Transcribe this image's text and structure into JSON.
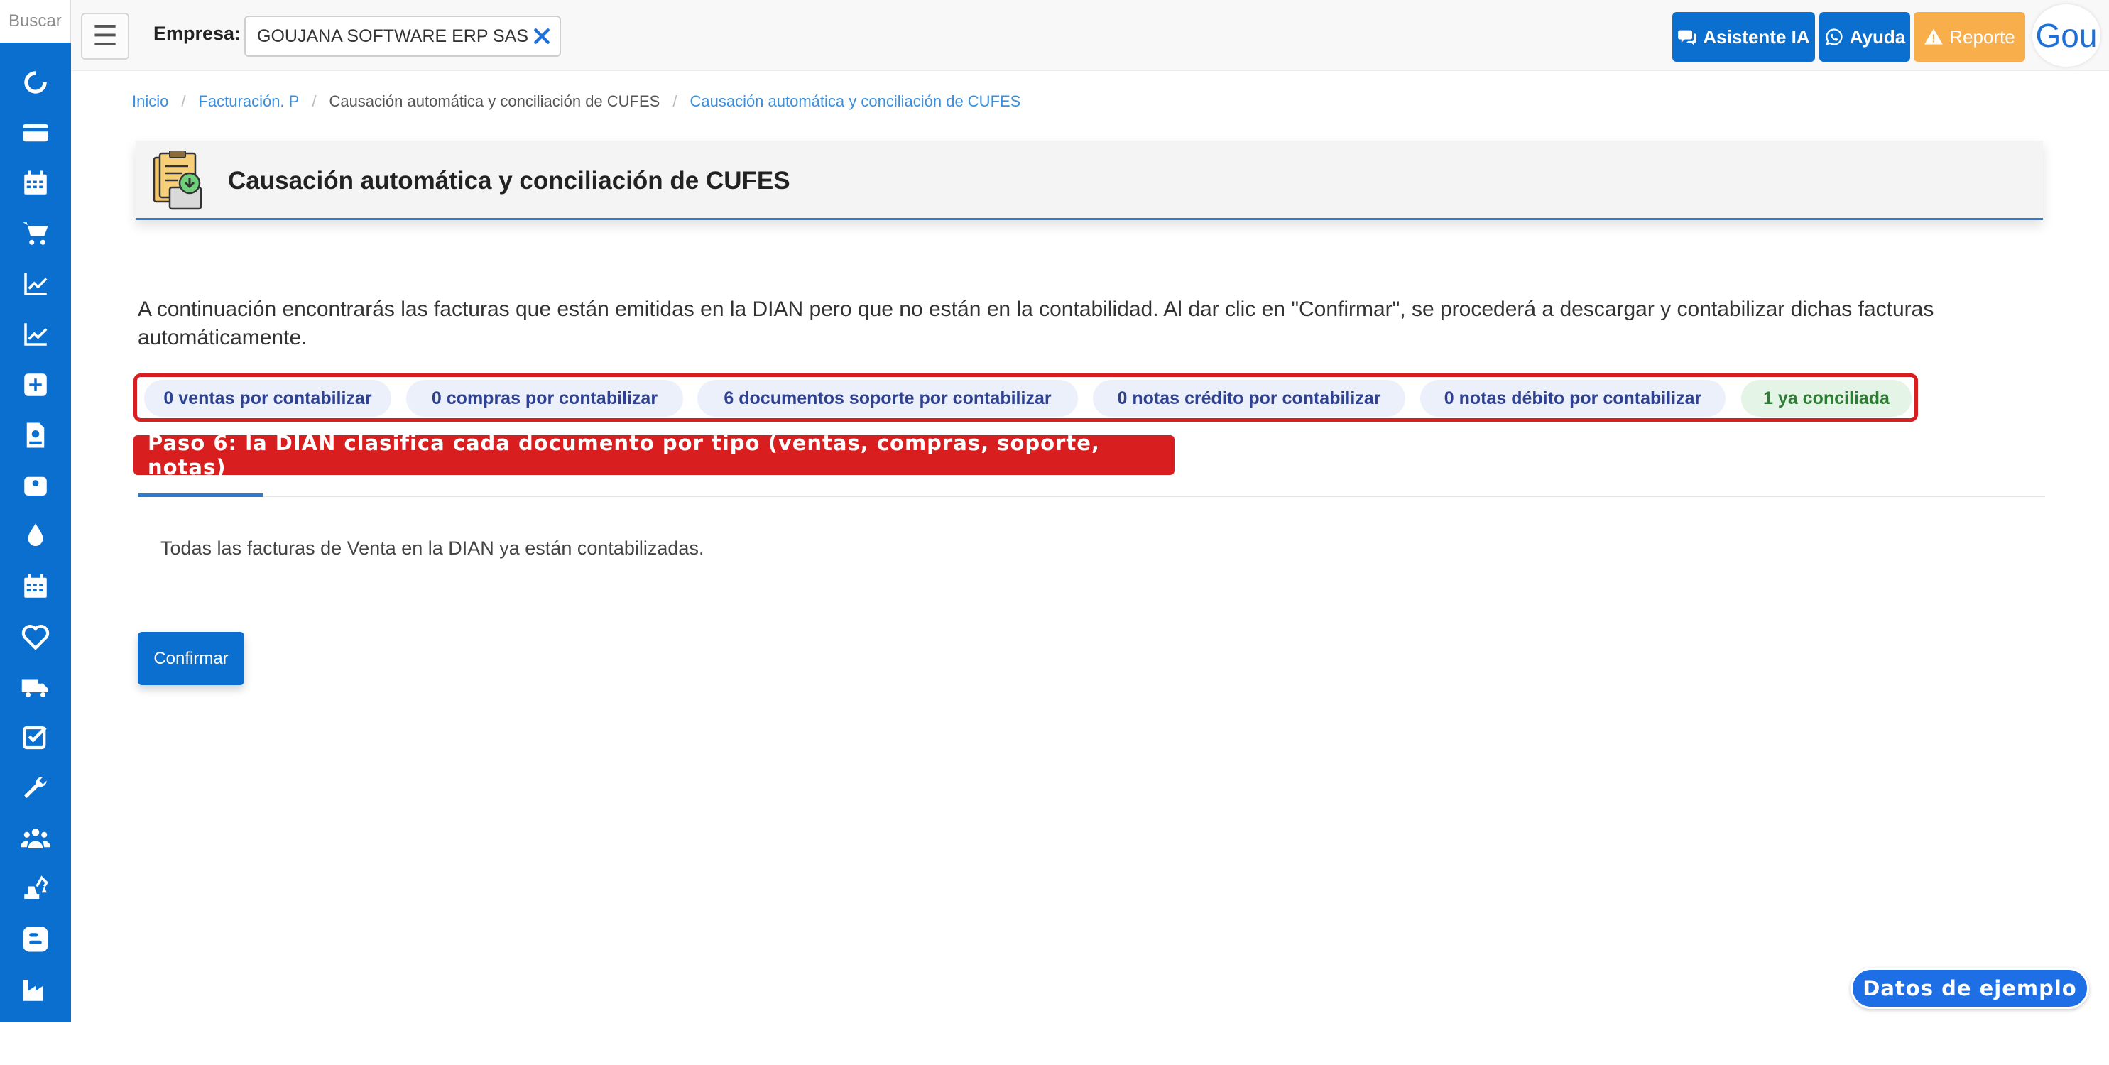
{
  "sidebar": {
    "search_placeholder": "Buscar",
    "icons": [
      "refresh-icon",
      "credit-card-icon",
      "calendar-icon",
      "cart-icon",
      "line-chart-icon",
      "line-chart-icon",
      "plus-square-icon",
      "rips-document-icon",
      "wallet-icon",
      "drop-icon",
      "calendar-icon",
      "heart-icon",
      "truck-icon",
      "check-square-icon",
      "wrench-icon",
      "users-icon",
      "excavator-icon",
      "blogger-icon",
      "industry-icon",
      "support-agent-icon"
    ]
  },
  "topbar": {
    "menu_icon": "☰",
    "empresa_label": "Empresa:",
    "empresa_value": "GOUJANA SOFTWARE ERP SAS",
    "asistente_label": "Asistente IA",
    "ayuda_label": "Ayuda",
    "reporte_label": "Reporte",
    "logo_text": "Gou",
    "colors": {
      "primary": "#0b6fd0",
      "warning": "#f7ae4b"
    }
  },
  "breadcrumb": {
    "items": [
      "Inicio",
      "Facturación. P",
      "Causación automática y conciliación de CUFES",
      "Causación automática y conciliación de CUFES"
    ],
    "separator": "/"
  },
  "header": {
    "title": "Causación automática y conciliación de CUFES"
  },
  "intro": {
    "text": "A continuación encontrarás las facturas que están emitidas en la DIAN pero que no están en la contabilidad. Al dar clic en \"Confirmar\", se procederá a descargar y contabilizar dichas facturas automáticamente."
  },
  "pills": [
    {
      "label": "0 ventas por contabilizar"
    },
    {
      "label": "0 compras por contabilizar"
    },
    {
      "label": "6 documentos soporte por contabilizar"
    },
    {
      "label": "0 notas crédito por contabilizar"
    },
    {
      "label": "0 notas débito por contabilizar"
    },
    {
      "label": "1 ya conciliada"
    }
  ],
  "annotation": {
    "text": "Paso 6: la DIAN clasifica cada documento por tipo (ventas, compras, soporte, notas)",
    "color": "#d81e1e"
  },
  "content": {
    "empty_message": "Todas las facturas de Venta en la DIAN ya están contabilizadas.",
    "confirm_label": "Confirmar"
  },
  "badge": {
    "text": "Datos de ejemplo"
  }
}
